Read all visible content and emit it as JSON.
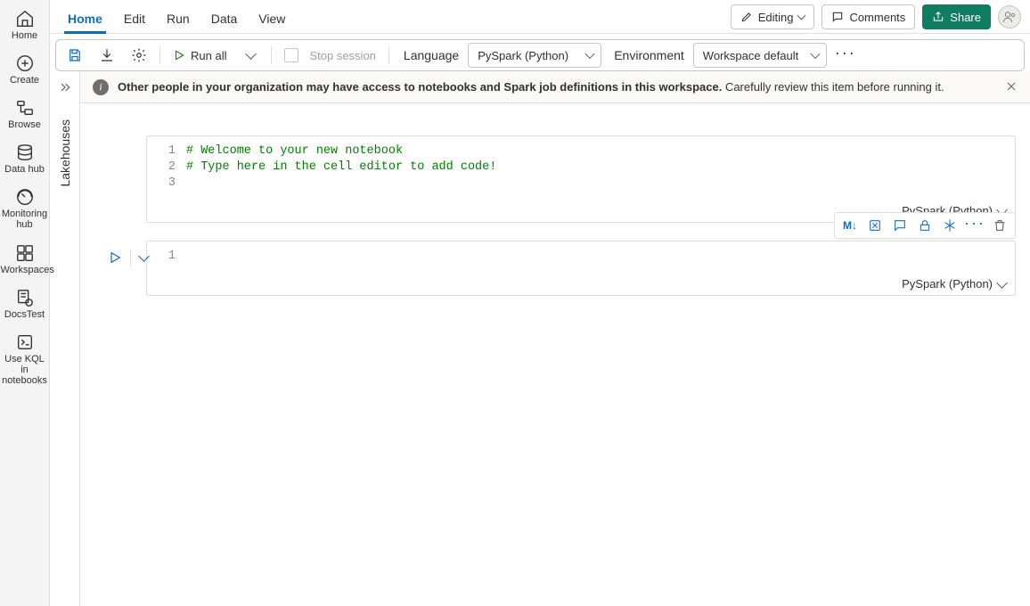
{
  "rail": {
    "items": [
      {
        "icon": "home-icon",
        "label": "Home"
      },
      {
        "icon": "plus-circle-icon",
        "label": "Create"
      },
      {
        "icon": "folder-tree-icon",
        "label": "Browse"
      },
      {
        "icon": "database-icon",
        "label": "Data hub"
      },
      {
        "icon": "monitor-icon",
        "label": "Monitoring hub"
      },
      {
        "icon": "workspaces-icon",
        "label": "Workspaces"
      },
      {
        "icon": "docstest-icon",
        "label": "DocsTest"
      },
      {
        "icon": "kql-icon",
        "label": "Use KQL in notebooks"
      }
    ]
  },
  "tabs": {
    "items": [
      "Home",
      "Edit",
      "Run",
      "Data",
      "View"
    ],
    "active": "Home"
  },
  "header_actions": {
    "editing": "Editing",
    "comments": "Comments",
    "share": "Share"
  },
  "toolbar": {
    "run_all": "Run all",
    "stop_session": "Stop session",
    "language_label": "Language",
    "language_value": "PySpark (Python)",
    "environment_label": "Environment",
    "environment_value": "Workspace default"
  },
  "sidebar": {
    "vertical_label": "Lakehouses"
  },
  "banner": {
    "bold": "Other people in your organization may have access to notebooks and Spark job definitions in this workspace.",
    "rest": "Carefully review this item before running it."
  },
  "cells": [
    {
      "lang": "PySpark (Python)",
      "selected": false,
      "lines": [
        "# Welcome to your new notebook",
        "# Type here in the cell editor to add code!",
        ""
      ]
    },
    {
      "lang": "PySpark (Python)",
      "selected": true,
      "lines": [
        ""
      ]
    }
  ],
  "cell_toolbar": {
    "md_label": "M↓"
  }
}
